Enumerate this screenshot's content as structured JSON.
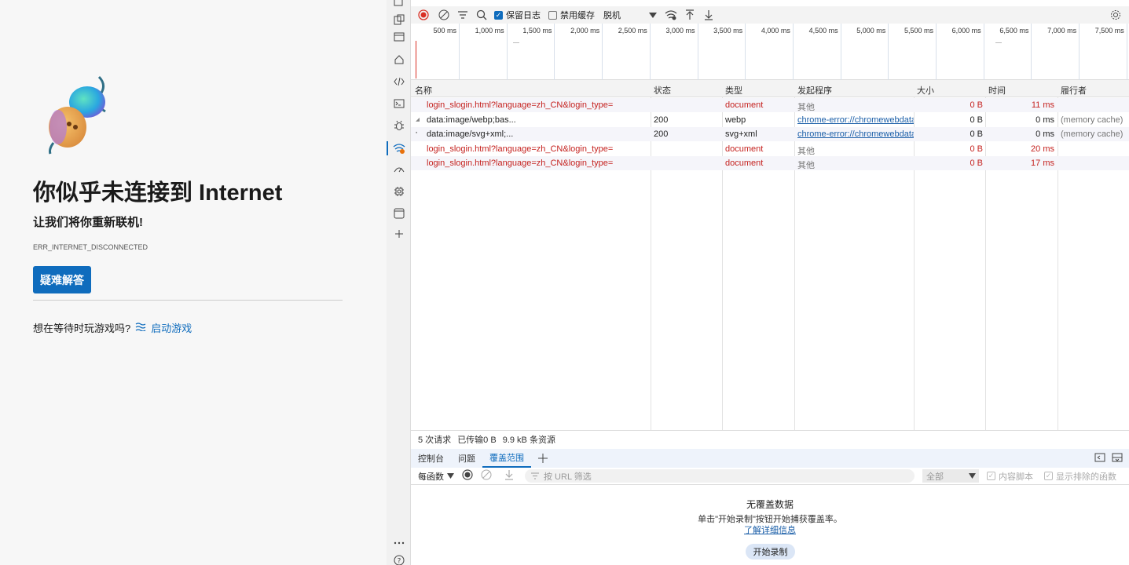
{
  "offline_page": {
    "title": "你似乎未连接到 Internet",
    "subtitle": "让我们将你重新联机!",
    "error_code": "ERR_INTERNET_DISCONNECTED",
    "troubleshoot_label": "疑难解答",
    "game_prompt": "想在等待时玩游戏吗?",
    "game_link": "启动游戏"
  },
  "network_toolbar": {
    "preserve_log_label": "保留日志",
    "preserve_log_checked": true,
    "disable_cache_label": "禁用缓存",
    "disable_cache_checked": false,
    "throttle_value": "脱机"
  },
  "timeline": {
    "ticks": [
      "500 ms",
      "1,000 ms",
      "1,500 ms",
      "2,000 ms",
      "2,500 ms",
      "3,000 ms",
      "3,500 ms",
      "4,000 ms",
      "4,500 ms",
      "5,000 ms",
      "5,500 ms",
      "6,000 ms",
      "6,500 ms",
      "7,000 ms",
      "7,500 ms"
    ]
  },
  "table": {
    "headers": {
      "name": "名称",
      "status": "状态",
      "type": "类型",
      "initiator": "发起程序",
      "size": "大小",
      "time": "时间",
      "fulfilled_by": "履行者"
    },
    "rows": [
      {
        "name": "login_slogin.html?language=zh_CN&login_type=",
        "status": "",
        "type": "document",
        "initiator": "其他",
        "size": "0 B",
        "time": "11 ms",
        "fulfilled_by": "",
        "failed": true
      },
      {
        "name": "data:image/webp;bas...",
        "status": "200",
        "type": "webp",
        "initiator": "chrome-error://chromewebdata",
        "size": "0 B",
        "time": "0 ms",
        "fulfilled_by": "(memory cache)",
        "failed": false
      },
      {
        "name": "data:image/svg+xml;...",
        "status": "200",
        "type": "svg+xml",
        "initiator": "chrome-error://chromewebdata",
        "size": "0 B",
        "time": "0 ms",
        "fulfilled_by": "(memory cache)",
        "failed": false
      },
      {
        "name": "login_slogin.html?language=zh_CN&login_type=",
        "status": "",
        "type": "document",
        "initiator": "其他",
        "size": "0 B",
        "time": "20 ms",
        "fulfilled_by": "",
        "failed": true
      },
      {
        "name": "login_slogin.html?language=zh_CN&login_type=",
        "status": "",
        "type": "document",
        "initiator": "其他",
        "size": "0 B",
        "time": "17 ms",
        "fulfilled_by": "",
        "failed": true
      }
    ]
  },
  "summary": {
    "requests": "5 次请求",
    "transferred": "已传输0 B",
    "resources": "9.9 kB 条资源"
  },
  "drawer": {
    "tabs": [
      "控制台",
      "问题",
      "覆盖范围"
    ],
    "active_tab": "覆盖范围",
    "per_function_label": "每函数",
    "url_filter_placeholder": "按 URL 筛选",
    "type_filter": "全部",
    "content_scripts_label": "内容脚本",
    "show_excluded_label": "显示排除的函数",
    "empty_title": "无覆盖数据",
    "empty_desc": "单击\"开始录制\"按钮开始捕获覆盖率。",
    "learn_more": "了解详细信息",
    "start_recording": "开始录制"
  },
  "colors": {
    "accent": "#0f6cbd",
    "error_text": "#c5221f",
    "link": "#1a5ea8"
  }
}
